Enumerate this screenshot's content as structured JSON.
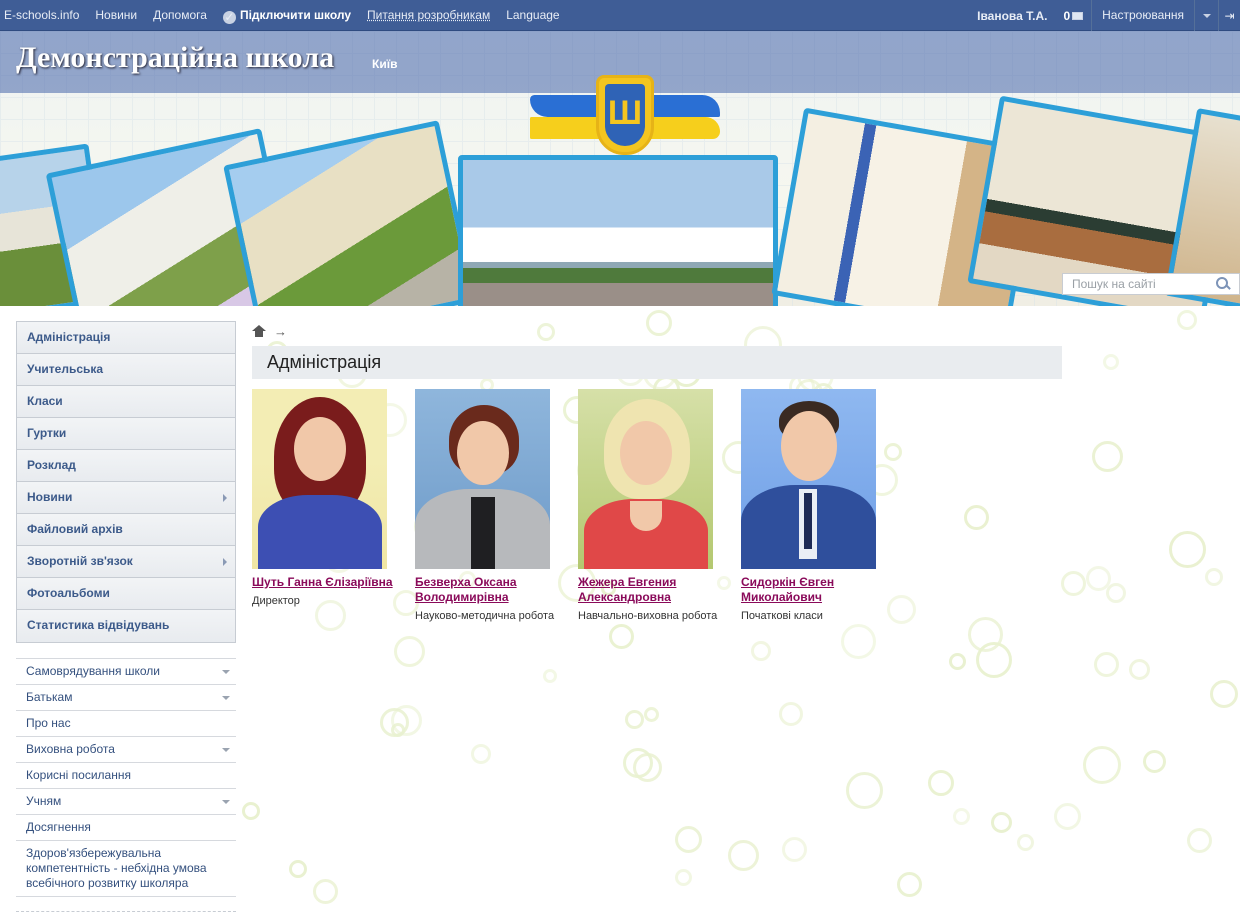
{
  "topbar": {
    "brand": "E-schools.info",
    "news": "Новини",
    "help": "Допомога",
    "connect": "Підключити школу",
    "dev": "Питання розробникам",
    "language": "Language",
    "user": "Іванова Т.А.",
    "messages_count": "0",
    "settings": "Настроювання"
  },
  "header": {
    "school_name": "Демонстраційна школа",
    "city": "Київ",
    "search_placeholder": "Пошук на сайті"
  },
  "sidebar": {
    "primary": [
      {
        "label": "Адміністрація",
        "has_submenu": false
      },
      {
        "label": "Учительська",
        "has_submenu": false
      },
      {
        "label": "Класи",
        "has_submenu": false
      },
      {
        "label": "Гуртки",
        "has_submenu": false
      },
      {
        "label": "Розклад",
        "has_submenu": false
      },
      {
        "label": "Новини",
        "has_submenu": true
      },
      {
        "label": "Файловий архів",
        "has_submenu": false
      },
      {
        "label": "Зворотній зв'язок",
        "has_submenu": true
      },
      {
        "label": "Фотоальбоми",
        "has_submenu": false
      },
      {
        "label": "Статистика відвідувань",
        "has_submenu": false
      }
    ],
    "secondary": [
      {
        "label": "Самоврядування школи",
        "dropdown": true
      },
      {
        "label": "Батькам",
        "dropdown": true
      },
      {
        "label": "Про нас",
        "dropdown": false
      },
      {
        "label": "Виховна робота",
        "dropdown": true
      },
      {
        "label": "Корисні посилання",
        "dropdown": false
      },
      {
        "label": "Учням",
        "dropdown": true
      },
      {
        "label": "Досягнення",
        "dropdown": false
      },
      {
        "label": "Здоров'язбережувальна компетентність - небхідна умова всебічного розвитку школяра",
        "dropdown": false
      }
    ]
  },
  "main": {
    "breadcrumb_arrow": "→",
    "title": "Адміністрація",
    "staff": [
      {
        "name": "Шуть Ганна Єлізаріївна",
        "role": "Директор"
      },
      {
        "name": "Безверха Оксана Володимирівна",
        "role": "Науково-методична робота"
      },
      {
        "name": "Жежера Евгения Александровна",
        "role": "Навчально-виховна робота"
      },
      {
        "name": "Сидоркін Євген Миколайович",
        "role": "Початкові класи"
      }
    ]
  },
  "colors": {
    "topbar": "#3f5d96",
    "menu_text": "#3c5a8a",
    "person_name": "#8a0a5a"
  }
}
